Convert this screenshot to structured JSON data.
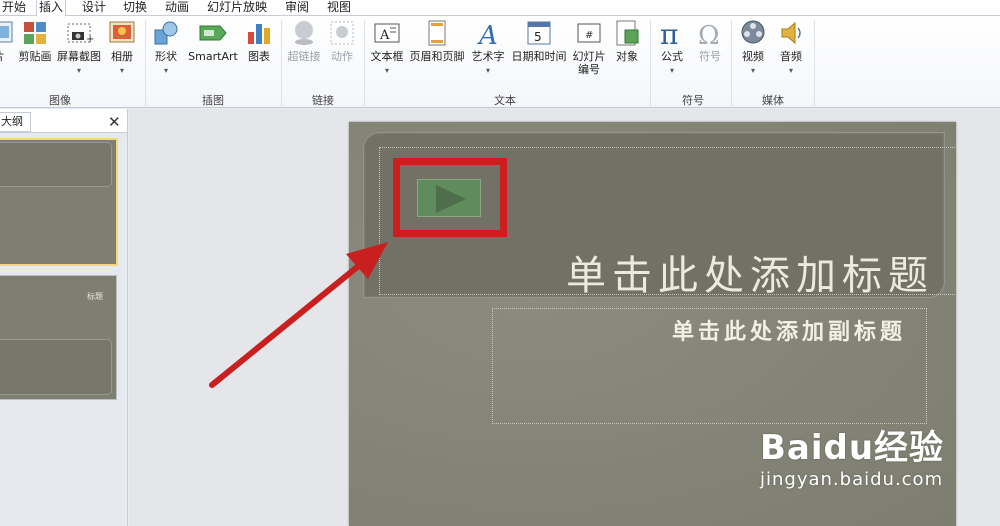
{
  "ribbon_tabs": [
    "开始",
    "插入",
    "设计",
    "切换",
    "动画",
    "幻灯片放映",
    "审阅",
    "视图"
  ],
  "active_tab": "插入",
  "groups": {
    "image": {
      "label": "图像",
      "buttons": [
        {
          "label": "片",
          "icon": "picture-icon"
        },
        {
          "label": "剪贴画",
          "icon": "clipart-icon"
        },
        {
          "label": "屏幕截图",
          "icon": "screenshot-icon"
        },
        {
          "label": "相册",
          "icon": "photo-album-icon"
        }
      ]
    },
    "illustrations": {
      "label": "插图",
      "buttons": [
        {
          "label": "形状",
          "icon": "shapes-icon"
        },
        {
          "label": "SmartArt",
          "icon": "smartart-icon"
        },
        {
          "label": "图表",
          "icon": "chart-icon"
        }
      ]
    },
    "links": {
      "label": "链接",
      "buttons": [
        {
          "label": "超链接",
          "icon": "hyperlink-icon"
        },
        {
          "label": "动作",
          "icon": "action-icon"
        }
      ]
    },
    "text": {
      "label": "文本",
      "buttons": [
        {
          "label": "文本框",
          "icon": "textbox-icon"
        },
        {
          "label": "页眉和页脚",
          "icon": "header-footer-icon"
        },
        {
          "label": "艺术字",
          "icon": "wordart-icon"
        },
        {
          "label": "日期和时间",
          "icon": "date-time-icon"
        },
        {
          "label": "幻灯片",
          "label2": "编号",
          "icon": "slide-number-icon"
        },
        {
          "label": "对象",
          "icon": "object-icon"
        }
      ]
    },
    "symbols": {
      "label": "符号",
      "buttons": [
        {
          "label": "公式",
          "icon": "equation-icon"
        },
        {
          "label": "符号",
          "icon": "symbol-icon"
        }
      ]
    },
    "media": {
      "label": "媒体",
      "buttons": [
        {
          "label": "视频",
          "icon": "video-icon"
        },
        {
          "label": "音频",
          "icon": "audio-icon"
        }
      ]
    }
  },
  "left_panel": {
    "tab_label": "大纲",
    "close_glyph": "✕",
    "thumb2_title": "标题"
  },
  "slide": {
    "title_placeholder": "单击此处添加标题",
    "subtitle_placeholder": "单击此处添加副标题"
  },
  "watermark": {
    "brand": "Baidu经验",
    "url": "jingyan.baidu.com"
  },
  "colors": {
    "highlight": "#cf1d1d",
    "arrow": "#c91f1f",
    "slide_bg": "#7f7f71"
  }
}
